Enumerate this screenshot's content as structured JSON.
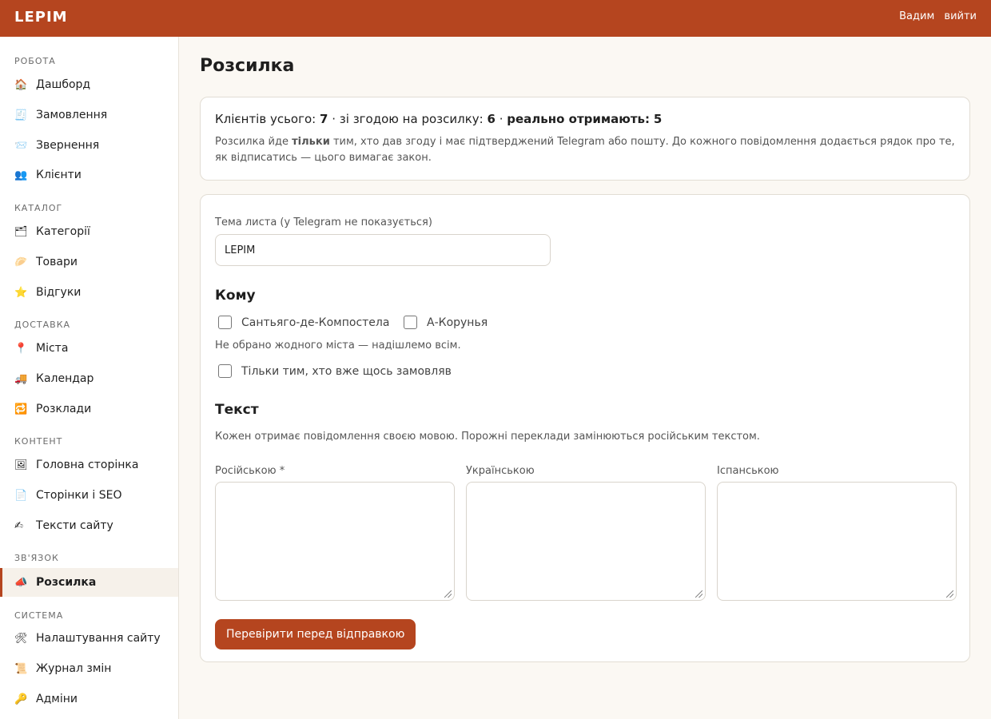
{
  "header": {
    "brand": "LEPIM",
    "user": "Вадим",
    "logout": "вийти",
    "bg_color": "#b5451f"
  },
  "sidebar": {
    "sections": [
      {
        "title": "РОБОТА",
        "items": [
          {
            "icon": "🏠",
            "label": "Дашборд"
          },
          {
            "icon": "🧾",
            "label": "Замовлення"
          },
          {
            "icon": "📨",
            "label": "Звернення"
          },
          {
            "icon": "👥",
            "label": "Клієнти"
          }
        ]
      },
      {
        "title": "КАТАЛОГ",
        "items": [
          {
            "icon": "🗂",
            "label": "Категорії"
          },
          {
            "icon": "🥟",
            "label": "Товари"
          },
          {
            "icon": "⭐",
            "label": "Відгуки"
          }
        ]
      },
      {
        "title": "ДОСТАВКА",
        "items": [
          {
            "icon": "📍",
            "label": "Міста"
          },
          {
            "icon": "🚚",
            "label": "Календар"
          },
          {
            "icon": "🔁",
            "label": "Розклади"
          }
        ]
      },
      {
        "title": "КОНТЕНТ",
        "items": [
          {
            "icon": "🖼",
            "label": "Головна сторінка"
          },
          {
            "icon": "📄",
            "label": "Сторінки і SEO"
          },
          {
            "icon": "✍",
            "label": "Тексти сайту"
          }
        ]
      },
      {
        "title": "ЗВ'ЯЗОК",
        "items": [
          {
            "icon": "📣",
            "label": "Розсилка",
            "active": true
          }
        ]
      },
      {
        "title": "СИСТЕМА",
        "items": [
          {
            "icon": "🛠",
            "label": "Налаштування сайту"
          },
          {
            "icon": "📜",
            "label": "Журнал змін"
          },
          {
            "icon": "🔑",
            "label": "Адміни"
          }
        ]
      }
    ]
  },
  "page": {
    "title": "Розсилка",
    "stats": {
      "clients_label": "Клієнтів усього:",
      "clients": "7",
      "consent_label": "зі згодою на розсилку:",
      "consent": "6",
      "receive_label": "реально отримають:",
      "receive": "5",
      "note_before": "Розсилка йде",
      "note_bold": "тільки",
      "note_after": "тим, хто дав згоду і має підтверджений Telegram або пошту. До кожного повідомлення додається рядок про те, як відписатись — цього вимагає закон."
    },
    "subject": {
      "label": "Тема листа (у Telegram не показується)",
      "value": "LEPIM"
    },
    "to": {
      "heading": "Кому",
      "cities": [
        "Сантьяго-де-Компостела",
        "А-Корунья"
      ],
      "hint": "Не обрано жодного міста — надішлемо всім.",
      "only_buyers": "Тільки тим, хто вже щось замовляв"
    },
    "text": {
      "heading": "Текст",
      "hint": "Кожен отримає повідомлення своєю мовою. Порожні переклади замінюються російським текстом.",
      "ru_label": "Російською *",
      "uk_label": "Українською",
      "es_label": "Іспанською"
    },
    "submit": "Перевірити перед відправкою"
  }
}
